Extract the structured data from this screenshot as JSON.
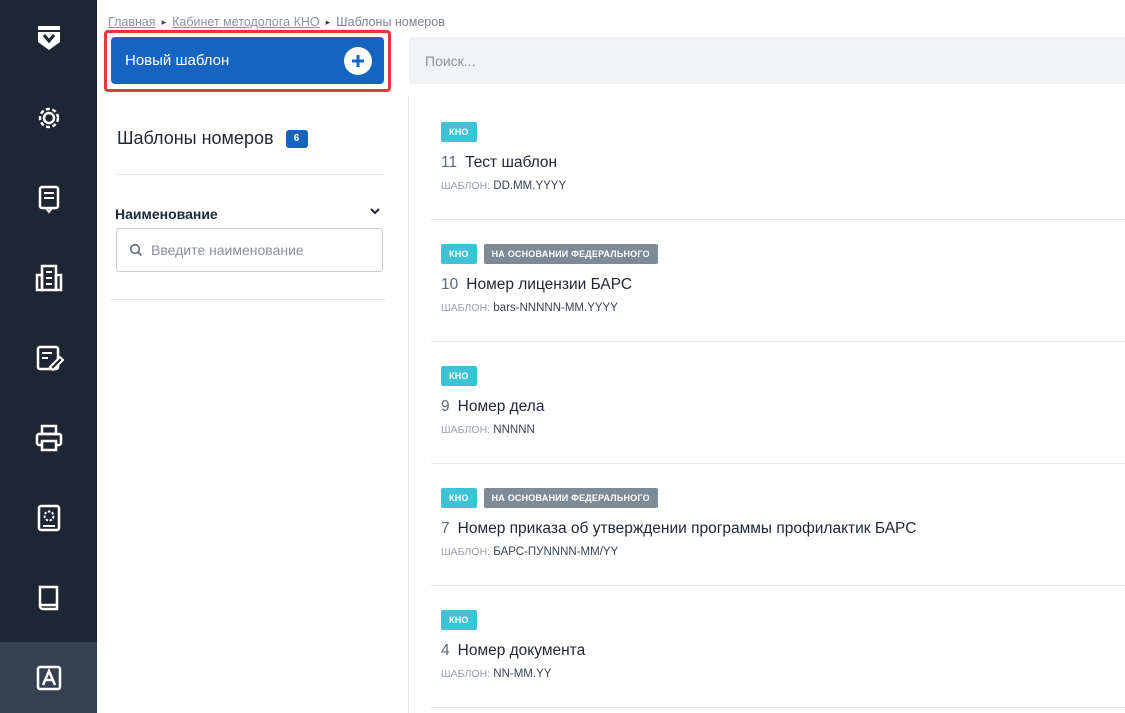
{
  "breadcrumb": [
    {
      "label": "Главная"
    },
    {
      "label": "Кабинет методолога КНО"
    },
    {
      "label": "Шаблоны номеров"
    }
  ],
  "new_button": {
    "label": "Новый шаблон"
  },
  "search": {
    "placeholder": "Поиск..."
  },
  "panel": {
    "title": "Шаблоны номеров",
    "count": "6",
    "filter_label": "Наименование",
    "filter_placeholder": "Введите наименование"
  },
  "template_key_label": "ШАБЛОН:",
  "items": [
    {
      "tags": [
        "КНО"
      ],
      "num": "11",
      "name": "Тест шаблон",
      "pattern": "DD.MM.YYYY"
    },
    {
      "tags": [
        "КНО",
        "НА ОСНОВАНИИ ФЕДЕРАЛЬНОГО"
      ],
      "num": "10",
      "name": "Номер лицензии БАРС",
      "pattern": "bars-NNNNN-MM.YYYY"
    },
    {
      "tags": [
        "КНО"
      ],
      "num": "9",
      "name": "Номер дела",
      "pattern": "NNNNN"
    },
    {
      "tags": [
        "КНО",
        "НА ОСНОВАНИИ ФЕДЕРАЛЬНОГО"
      ],
      "num": "7",
      "name": "Номер приказа об утверждении программы профилактик БАРС",
      "pattern": "БАРС-ПУNNNN-MM/YY"
    },
    {
      "tags": [
        "КНО"
      ],
      "num": "4",
      "name": "Номер документа",
      "pattern": "NN-MM.YY"
    }
  ],
  "colors": {
    "accent": "#1565c0",
    "highlight": "#e03a3a",
    "kno_tag": "#3ec3d6",
    "fed_tag": "#7d8b96",
    "rail": "#1d2733"
  },
  "rail_icons": [
    "logo-shield-icon",
    "gear-icon",
    "document-list-icon",
    "building-icon",
    "form-edit-icon",
    "printer-icon",
    "settings-book-icon",
    "book-icon",
    "letter-a-icon"
  ]
}
